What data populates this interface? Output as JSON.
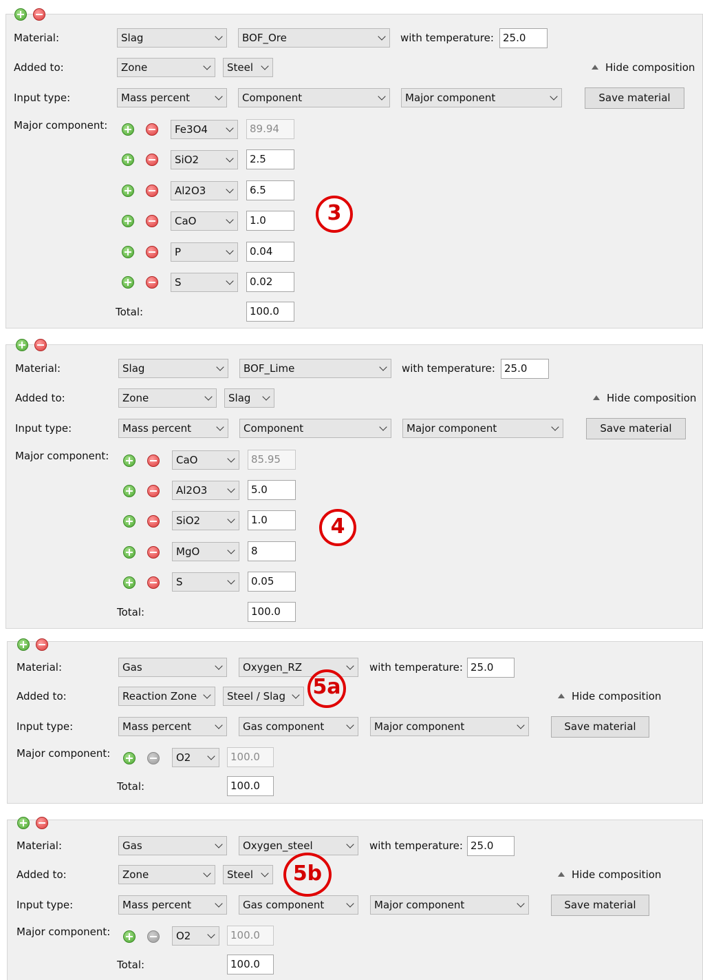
{
  "labels": {
    "material": "Material:",
    "added_to": "Added to:",
    "input_type": "Input type:",
    "major_component": "Major component:",
    "with_temperature": "with temperature:",
    "total": "Total:",
    "hide_composition": "Hide composition",
    "save_material": "Save material"
  },
  "panels": [
    {
      "badge": "3",
      "material_type": "Slag",
      "material_name": "BOF_Ore",
      "temperature": "25.0",
      "added_zone": "Zone",
      "added_phase": "Steel",
      "input_type": "Mass percent",
      "component_type": "Component",
      "component_level": "Major component",
      "components": [
        {
          "name": "Fe3O4",
          "value": "89.94"
        },
        {
          "name": "SiO2",
          "value": "2.5"
        },
        {
          "name": "Al2O3",
          "value": "6.5"
        },
        {
          "name": "CaO",
          "value": "1.0"
        },
        {
          "name": "P",
          "value": "0.04"
        },
        {
          "name": "S",
          "value": "0.02"
        }
      ],
      "total": "100.0"
    },
    {
      "badge": "4",
      "material_type": "Slag",
      "material_name": "BOF_Lime",
      "temperature": "25.0",
      "added_zone": "Zone",
      "added_phase": "Slag",
      "input_type": "Mass percent",
      "component_type": "Component",
      "component_level": "Major component",
      "components": [
        {
          "name": "CaO",
          "value": "85.95"
        },
        {
          "name": "Al2O3",
          "value": "5.0"
        },
        {
          "name": "SiO2",
          "value": "1.0"
        },
        {
          "name": "MgO",
          "value": "8"
        },
        {
          "name": "S",
          "value": "0.05"
        }
      ],
      "total": "100.0"
    },
    {
      "badge": "5a",
      "material_type": "Gas",
      "material_name": "Oxygen_RZ",
      "temperature": "25.0",
      "added_zone": "Reaction Zone",
      "added_phase": "Steel / Slag",
      "input_type": "Mass percent",
      "component_type": "Gas component",
      "component_level": "Major component",
      "components": [
        {
          "name": "O2",
          "value": "100.0"
        }
      ],
      "total": "100.0"
    },
    {
      "badge": "5b",
      "material_type": "Gas",
      "material_name": "Oxygen_steel",
      "temperature": "25.0",
      "added_zone": "Zone",
      "added_phase": "Steel",
      "input_type": "Mass percent",
      "component_type": "Gas component",
      "component_level": "Major component",
      "components": [
        {
          "name": "O2",
          "value": "100.0"
        }
      ],
      "total": "100.0"
    }
  ],
  "icons": {
    "add": "plus-circle-green",
    "remove": "minus-circle-red",
    "remove_disabled": "minus-circle-gray",
    "dropdown": "chevron-down",
    "hide": "triangle-up"
  },
  "colors": {
    "panel_bg": "#f0f0f0",
    "annotation_red": "#e00000",
    "add_green": "#4da832",
    "remove_red": "#db3b3b"
  }
}
